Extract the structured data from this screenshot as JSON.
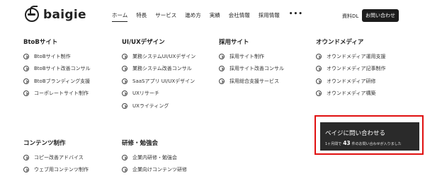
{
  "header": {
    "logo_text": "baigie",
    "nav": [
      "ホーム",
      "特長",
      "サービス",
      "進め方",
      "実績",
      "会社情報",
      "採用情報"
    ],
    "more_label": "•••",
    "doc_label": "資料DL",
    "contact_label": "お問い合わせ"
  },
  "columns": [
    {
      "title": "BtoBサイト",
      "items": [
        "BtoBサイト制作",
        "BtoBサイト改善コンサル",
        "BtoBブランディング支援",
        "コーポレートサイト制作"
      ]
    },
    {
      "title": "UI/UXデザイン",
      "items": [
        "業務システムUI/UXデザイン",
        "業務システム改善コンサル",
        "SaaSアプリ UI/UXデザイン",
        "UXリサーチ",
        "UXライティング"
      ]
    },
    {
      "title": "採用サイト",
      "items": [
        "採用サイト制作",
        "採用サイト改善コンサル",
        "採用総合支援サービス"
      ]
    },
    {
      "title": "オウンドメディア",
      "items": [
        "オウンドメディア運用支援",
        "オウンドメディア記事制作",
        "オウンドメディア研修",
        "オウンドメディア構築"
      ]
    },
    {
      "title": "コンテンツ制作",
      "items": [
        "コピー改善アドバイス",
        "ウェブ用コンテンツ制作"
      ]
    },
    {
      "title": "研修・勉強会",
      "items": [
        "企業内研修・勉強会",
        "企業向けコンテンツ研修"
      ]
    }
  ],
  "cta": {
    "title": "ベイジに問い合わせる",
    "sub_before": "1ヶ月間で",
    "sub_number": "43",
    "sub_after": "件のお問い合わせが入りました"
  },
  "colors": {
    "highlight": "#e01010",
    "cta_bg": "#2a2a2a",
    "button_bg": "#1c1c1c"
  }
}
